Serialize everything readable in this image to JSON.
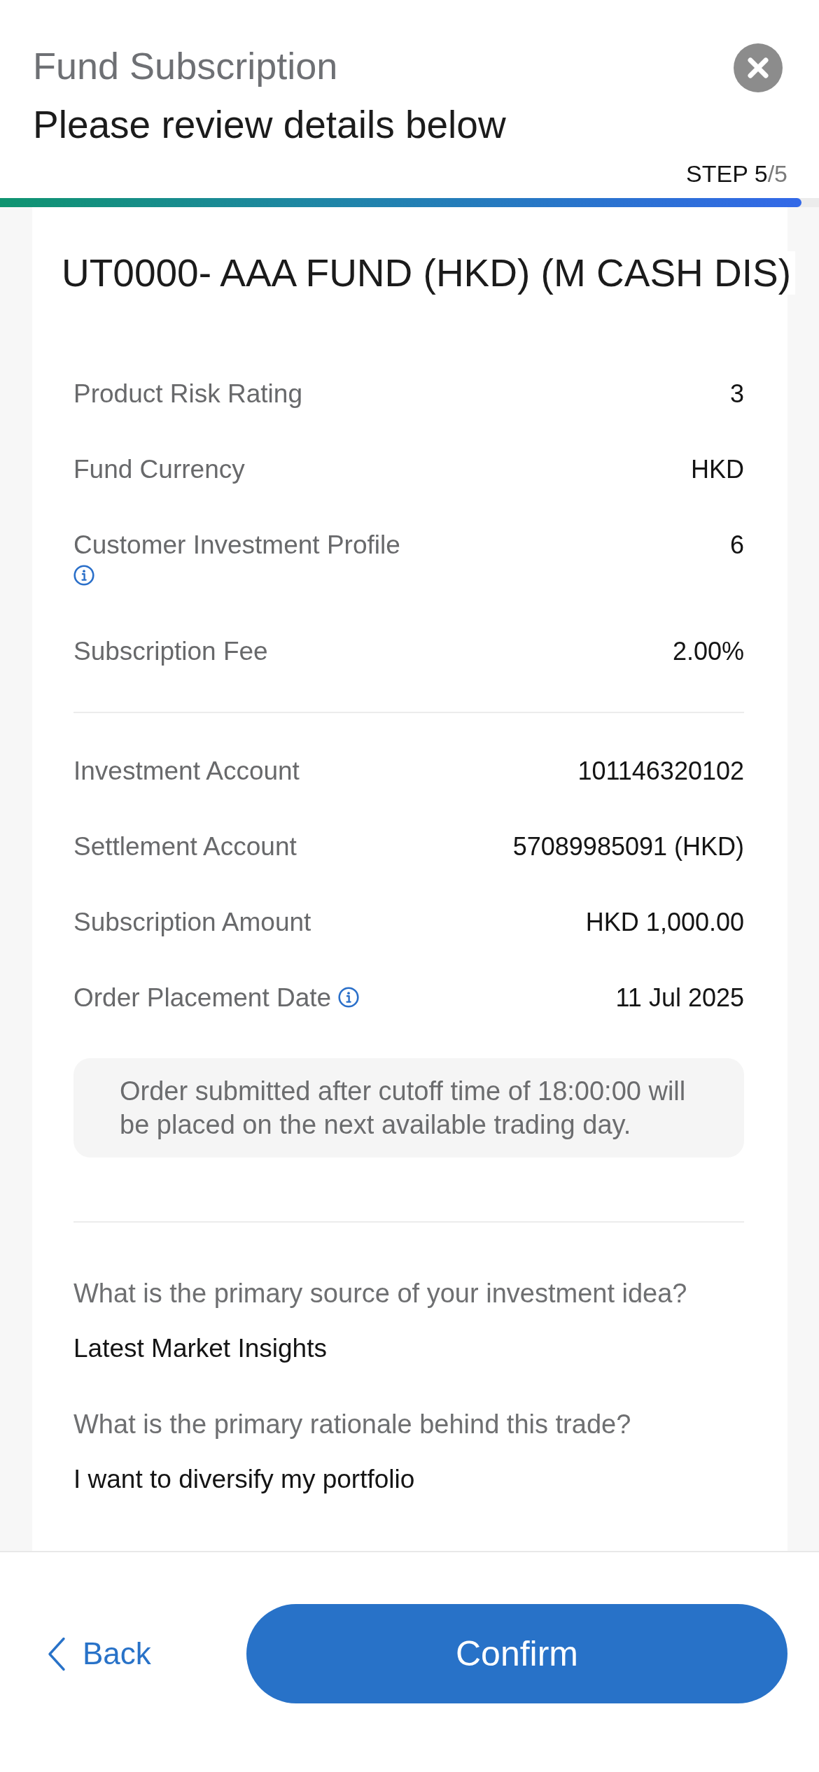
{
  "header": {
    "title": "Fund Subscription",
    "subtitle": "Please review details below",
    "step": {
      "label": "STEP 5",
      "total": "/5"
    },
    "progress": {
      "level": 1
    }
  },
  "fund": {
    "name": "UT0000- AAA FUND (HKD) (M CASH DIS)"
  },
  "product_details": [
    {
      "label": "Product Risk Rating",
      "value": "3",
      "info": false
    },
    {
      "label": "Fund Currency",
      "value": "HKD",
      "info": false
    },
    {
      "label": "Customer Investment Profile",
      "value": "6",
      "info": true
    },
    {
      "label": "Subscription Fee",
      "value": "2.00%",
      "info": false
    }
  ],
  "account_details": [
    {
      "label": "Investment Account",
      "value": "101146320102",
      "info": false
    },
    {
      "label": "Settlement Account",
      "value": "57089985091 (HKD)",
      "info": false
    },
    {
      "label": "Subscription Amount",
      "value": "HKD 1,000.00",
      "info": false
    },
    {
      "label": "Order Placement Date",
      "value": "11 Jul 2025",
      "info": true
    }
  ],
  "cutoff_note": "Order submitted after cutoff time of 18:00:00 will be placed on the next available trading day.",
  "questions": [
    {
      "question": "What is the primary source of your investment idea?",
      "answer": "Latest Market Insights"
    },
    {
      "question": "What is the primary rationale behind this trade?",
      "answer": "I want to diversify my portfolio"
    }
  ],
  "footer": {
    "back": "Back",
    "confirm": "Confirm"
  }
}
